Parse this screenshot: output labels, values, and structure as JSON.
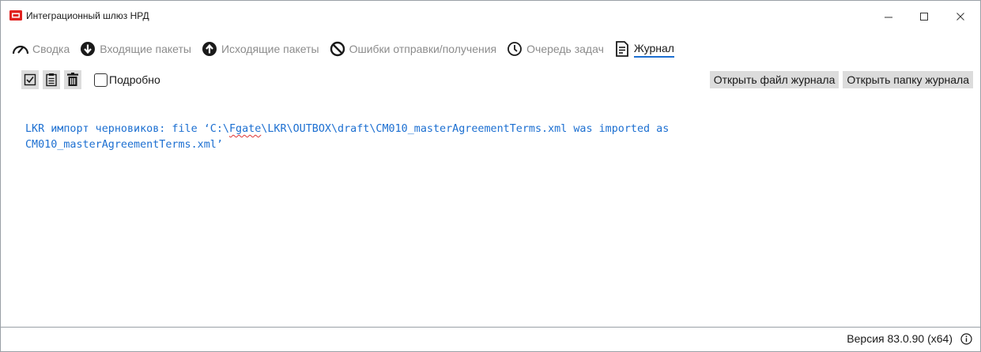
{
  "window": {
    "title": "Интеграционный шлюз НРД",
    "accent_color": "#e1211f",
    "controls": {
      "minimize": "minimize-icon",
      "maximize": "maximize-icon",
      "close": "close-icon"
    }
  },
  "nav": {
    "items": [
      {
        "label": "Сводка",
        "icon": "gauge-icon",
        "active": false
      },
      {
        "label": "Входящие пакеты",
        "icon": "arrow-down-circle-icon",
        "active": false
      },
      {
        "label": "Исходящие пакеты",
        "icon": "arrow-up-circle-icon",
        "active": false
      },
      {
        "label": "Ошибки отправки/получения",
        "icon": "prohibited-icon",
        "active": false
      },
      {
        "label": "Очередь задач",
        "icon": "clock-icon",
        "active": false
      },
      {
        "label": "Журнал",
        "icon": "document-icon",
        "active": true
      }
    ],
    "active_underline_color": "#1c6fd1"
  },
  "toolbar": {
    "buttons": [
      "select-all-icon",
      "copy-icon",
      "delete-icon"
    ],
    "detailed_checkbox": {
      "label": "Подробно",
      "checked": false
    },
    "open_log_file_label": "Открыть файл журнала",
    "open_log_folder_label": "Открыть папку журнала"
  },
  "log": {
    "color": "#1c6fd1",
    "line1_pre": "LKR импорт черновиков: file ‘C:\\",
    "line1_squiggle": "Fgate",
    "line1_post": "\\LKR\\OUTBOX\\draft\\CM010_masterAgreementTerms.xml was imported as",
    "line2": "CM010_masterAgreementTerms.xml’"
  },
  "status": {
    "version": "Версия 83.0.90 (x64)",
    "info_icon": "info-icon"
  }
}
